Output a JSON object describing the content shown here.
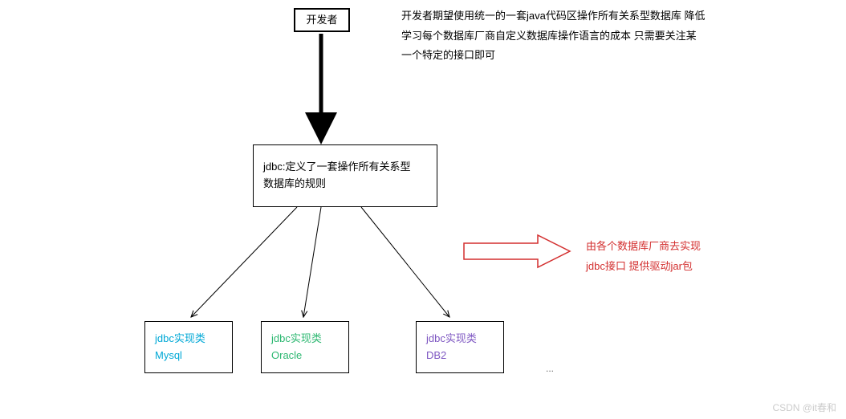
{
  "developer": {
    "label": "开发者"
  },
  "description": {
    "text": "开发者期望使用统一的一套java代码区操作所有关系型数据库 降低学习每个数据库厂商自定义数据库操作语言的成本 只需要关注某一个特定的接口即可"
  },
  "jdbc_def": {
    "line1": "jdbc:定义了一套操作所有关系型",
    "line2": "数据库的规则"
  },
  "impls": {
    "mysql": {
      "line1": "jdbc实现类",
      "line2": "Mysql"
    },
    "oracle": {
      "line1": "jdbc实现类",
      "line2": "Oracle"
    },
    "db2": {
      "line1": "jdbc实现类",
      "line2": "DB2"
    }
  },
  "ellipsis": "...",
  "vendor_note": {
    "text": "由各个数据库厂商去实现jdbc接口 提供驱动jar包"
  },
  "watermark": "CSDN @it春和",
  "colors": {
    "mysql": "#00a8d6",
    "oracle": "#2eb872",
    "db2": "#7e57c2",
    "red_note": "#d32f2f",
    "black": "#000000"
  }
}
